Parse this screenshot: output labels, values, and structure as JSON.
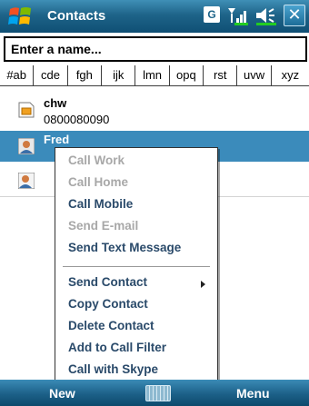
{
  "titlebar": {
    "title": "Contacts",
    "indicator_g": "G"
  },
  "search": {
    "placeholder": "Enter a name..."
  },
  "alpha_tabs": [
    "#ab",
    "cde",
    "fgh",
    "ijk",
    "lmn",
    "opq",
    "rst",
    "uvw",
    "xyz"
  ],
  "contacts": [
    {
      "name": "chw",
      "detail": "0800080090",
      "icon": "sim-card-icon"
    },
    {
      "name": "Fred",
      "detail": "",
      "icon": "contact-person-icon"
    },
    {
      "name": "",
      "detail": "",
      "icon": "contact-card-icon"
    }
  ],
  "context_menu": {
    "call_work": "Call Work",
    "call_home": "Call Home",
    "call_mobile": "Call Mobile",
    "send_email": "Send E-mail",
    "send_text": "Send Text Message",
    "send_contact": "Send Contact",
    "copy_contact": "Copy Contact",
    "delete_contact": "Delete Contact",
    "add_call_filter": "Add to Call Filter",
    "call_skype": "Call with Skype"
  },
  "softkeys": {
    "left": "New",
    "right": "Menu"
  },
  "colors": {
    "title_bar": "#1e6489",
    "selection": "#3b8bbb",
    "menu_text": "#2a4a6a",
    "disabled_text": "#a8a8a8"
  }
}
